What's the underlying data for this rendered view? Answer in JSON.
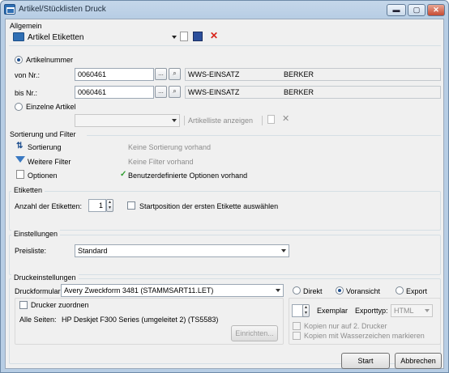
{
  "window": {
    "title": "Artikel/Stücklisten Druck",
    "buttons": {
      "minimize": "▬",
      "maximize": "▢",
      "close": "✕"
    }
  },
  "allgemein": {
    "title": "Allgemein",
    "template": "Artikel Etiketten"
  },
  "articles": {
    "artikelnummer_label": "Artikelnummer",
    "von_label": "von Nr.:",
    "von_value": "0060461",
    "von_desc": "WWS-EINSATZ",
    "von_brand": "BERKER",
    "bis_label": "bis Nr.:",
    "bis_value": "0060461",
    "bis_desc": "WWS-EINSATZ",
    "bis_brand": "BERKER",
    "einzelne_label": "Einzelne Artikel",
    "artikelliste_label": "Artikelliste anzeigen",
    "browse": "...",
    "mode": "artikelnummer"
  },
  "sortierung": {
    "title": "Sortierung und Filter",
    "sort_label": "Sortierung",
    "sort_status": "Keine Sortierung vorhand",
    "filter_label": "Weitere Filter",
    "filter_status": "Keine Filter vorhand",
    "options_label": "Optionen",
    "options_status": "Benutzerdefinierte Optionen vorhand"
  },
  "etiketten": {
    "title": "Etiketten",
    "anzahl_label": "Anzahl der Etiketten:",
    "anzahl_value": "1",
    "startpos_label": "Startposition der ersten Etikette auswählen"
  },
  "einstellungen": {
    "title": "Einstellungen",
    "preisliste_label": "Preisliste:",
    "preisliste_value": "Standard"
  },
  "druck": {
    "title": "Druckeinstellungen",
    "formular_label": "Druckformular:",
    "formular_value": "Avery Zweckform 3481 (STAMMSART11.LET)",
    "drucker_zuordnen": "Drucker zuordnen",
    "alle_seiten_label": "Alle Seiten:",
    "printer": "HP Deskjet F300 Series (umgeleitet 2) (TS5583)",
    "einrichten": "Einrichten...",
    "direkt": "Direkt",
    "voransicht": "Voransicht",
    "export": "Export",
    "output_mode": "voransicht",
    "exemplar_label": "Exemplar",
    "exporttyp_label": "Exporttyp:",
    "exporttyp_value": "HTML",
    "kopien_2": "Kopien nur auf 2. Drucker",
    "kopien_wz": "Kopien mit Wasserzeichen markieren"
  },
  "footer": {
    "start": "Start",
    "abbrechen": "Abbrechen"
  }
}
